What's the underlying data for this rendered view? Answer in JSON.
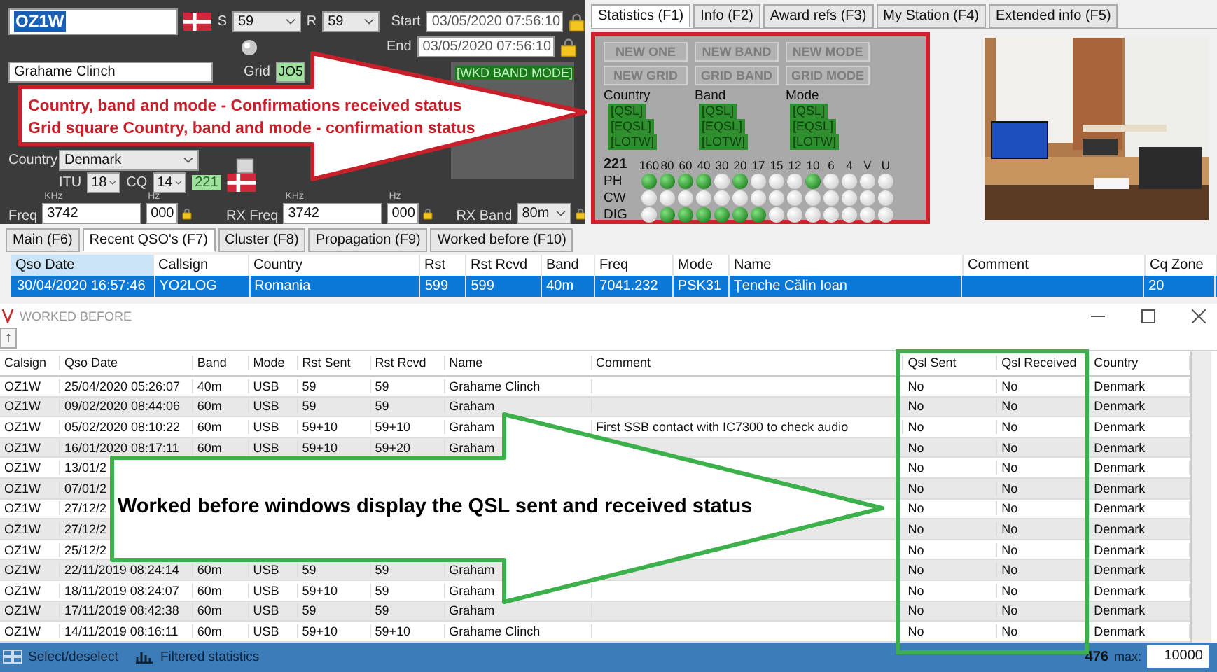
{
  "entry_panel": {
    "callsign": "OZ1W",
    "s_label": "S",
    "s_value": "59",
    "r_label": "R",
    "r_value": "59",
    "start_label": "Start",
    "start": "03/05/2020 07:56:10",
    "end_label": "End",
    "end": "03/05/2020 07:56:10",
    "name": "Grahame Clinch",
    "grid_label": "Grid",
    "grid": "JO5",
    "wkd_tags": [
      "[WKD BAND MODE]"
    ],
    "country_label": "Country",
    "country": "Denmark",
    "itu_label": "ITU",
    "itu": "18",
    "cq_label": "CQ",
    "cq": "14",
    "count": "221",
    "khz_unit": "KHz",
    "hz_unit": "Hz",
    "freq_label": "Freq",
    "freq": "3742",
    "freq_hz": "000",
    "rx_freq_label": "RX Freq",
    "rx_khz_unit": "KHz",
    "rx_hz_unit": "Hz",
    "rx_freq": "3742",
    "rx_freq_hz": "000",
    "rx_band_label": "RX Band",
    "rx_band": "80m"
  },
  "info_tabs": [
    {
      "label": "Statistics (F1)",
      "selected": true
    },
    {
      "label": "Info (F2)",
      "selected": false
    },
    {
      "label": "Award refs (F3)",
      "selected": false
    },
    {
      "label": "My Station (F4)",
      "selected": false
    },
    {
      "label": "Extended info (F5)",
      "selected": false
    }
  ],
  "statistics": {
    "alerts": [
      {
        "label": "NEW ONE",
        "disabled": true
      },
      {
        "label": "NEW BAND",
        "disabled": true
      },
      {
        "label": "NEW MODE",
        "disabled": true
      },
      {
        "label": "NEW GRID",
        "disabled": true
      },
      {
        "label": "GRID BAND",
        "disabled": true
      },
      {
        "label": "GRID MODE",
        "disabled": true
      }
    ],
    "groups": [
      {
        "title": "Country",
        "tags": [
          "[QSL]",
          "[EQSL]",
          "[LOTW]"
        ]
      },
      {
        "title": "Band",
        "tags": [
          "[QSL]",
          "[EQSL]",
          "[LOTW]"
        ]
      },
      {
        "title": "Mode",
        "tags": [
          "[QSL]",
          "[EQSL]",
          "[LOTW]"
        ]
      }
    ],
    "total": "221",
    "bands": [
      "160",
      "80",
      "60",
      "40",
      "30",
      "20",
      "17",
      "15",
      "12",
      "10",
      "6",
      "4",
      "V",
      "U"
    ],
    "modes": [
      {
        "label": "PH",
        "worked": [
          true,
          true,
          true,
          true,
          false,
          true,
          false,
          false,
          false,
          true,
          false,
          false,
          false,
          false
        ]
      },
      {
        "label": "CW",
        "worked": [
          false,
          false,
          false,
          false,
          false,
          false,
          false,
          false,
          false,
          false,
          false,
          false,
          false,
          false
        ]
      },
      {
        "label": "DIG",
        "worked": [
          false,
          true,
          true,
          true,
          true,
          true,
          true,
          false,
          false,
          false,
          false,
          false,
          false,
          false
        ]
      }
    ]
  },
  "bottom_tabs": [
    {
      "label": "Main (F6)",
      "selected": false
    },
    {
      "label": "Recent QSO's (F7)",
      "selected": true
    },
    {
      "label": "Cluster (F8)",
      "selected": false
    },
    {
      "label": "Propagation (F9)",
      "selected": false
    },
    {
      "label": "Worked before (F10)",
      "selected": false
    }
  ],
  "recent_qsos": {
    "columns": [
      {
        "label": "Qso Date",
        "selected": true
      },
      {
        "label": "Callsign",
        "selected": false
      },
      {
        "label": "Country",
        "selected": false
      },
      {
        "label": "Rst",
        "selected": false
      },
      {
        "label": "Rst Rcvd",
        "selected": false
      },
      {
        "label": "Band",
        "selected": false
      },
      {
        "label": "Freq",
        "selected": false
      },
      {
        "label": "Mode",
        "selected": false
      },
      {
        "label": "Name",
        "selected": false
      },
      {
        "label": "Comment",
        "selected": false
      },
      {
        "label": "Cq Zone",
        "selected": false
      }
    ],
    "rows": [
      {
        "selected": true,
        "cells": [
          "30/04/2020 16:57:46",
          "YO2LOG",
          "Romania",
          "599",
          "599",
          "40m",
          "7041.232",
          "PSK31",
          "Țenche Călin Ioan",
          null,
          "20"
        ]
      }
    ]
  },
  "worked_before": {
    "title": "WORKED BEFORE",
    "toolbar_button": "↑",
    "columns": [
      "Calsign",
      "Qso Date",
      "Band",
      "Mode",
      "Rst Sent",
      "Rst Rcvd",
      "Name",
      "Comment",
      "Qsl Sent",
      "Qsl Received",
      "Country"
    ],
    "rows": [
      [
        "OZ1W",
        "25/04/2020 05:26:07",
        "40m",
        "USB",
        "59",
        "59",
        "Grahame Clinch",
        null,
        "No",
        "No",
        "Denmark"
      ],
      [
        "OZ1W",
        "09/02/2020 08:44:06",
        "60m",
        "USB",
        "59",
        "59",
        "Graham",
        null,
        "No",
        "No",
        "Denmark"
      ],
      [
        "OZ1W",
        "05/02/2020 08:10:22",
        "60m",
        "USB",
        "59+10",
        "59+10",
        "Graham",
        "First SSB contact with IC7300 to check audio",
        "No",
        "No",
        "Denmark"
      ],
      [
        "OZ1W",
        "16/01/2020 08:17:11",
        "60m",
        "USB",
        "59+10",
        "59+20",
        "Graham",
        null,
        "No",
        "No",
        "Denmark"
      ],
      [
        "OZ1W",
        "13/01/2",
        null,
        null,
        null,
        null,
        null,
        null,
        "No",
        "No",
        "Denmark"
      ],
      [
        "OZ1W",
        "07/01/2",
        null,
        null,
        null,
        null,
        null,
        null,
        "No",
        "No",
        "Denmark"
      ],
      [
        "OZ1W",
        "27/12/2",
        null,
        null,
        null,
        null,
        null,
        null,
        "No",
        "No",
        "Denmark"
      ],
      [
        "OZ1W",
        "27/12/2",
        null,
        null,
        null,
        null,
        null,
        null,
        "No",
        "No",
        "Denmark"
      ],
      [
        "OZ1W",
        "25/12/2",
        null,
        null,
        null,
        null,
        null,
        null,
        "No",
        "No",
        "Denmark"
      ],
      [
        "OZ1W",
        "22/11/2019 08:24:14",
        "60m",
        "USB",
        "59",
        "59",
        "Graham",
        null,
        "No",
        "No",
        "Denmark"
      ],
      [
        "OZ1W",
        "18/11/2019 08:24:07",
        "60m",
        "USB",
        "59+10",
        "59",
        "Graham",
        null,
        "No",
        "No",
        "Denmark"
      ],
      [
        "OZ1W",
        "17/11/2019 08:42:38",
        "60m",
        "USB",
        "59",
        "59",
        "Graham",
        null,
        "No",
        "No",
        "Denmark"
      ],
      [
        "OZ1W",
        "14/11/2019 08:16:11",
        "60m",
        "USB",
        "59+10",
        "59+10",
        "Grahame Clinch",
        null,
        "No",
        "No",
        "Denmark"
      ]
    ],
    "status": {
      "select": "Select/deselect",
      "filtered": "Filtered statistics",
      "total": "476",
      "max_label": "max:",
      "max": "10000"
    }
  },
  "annotations": [
    {
      "kind": "red-arrow",
      "lines": [
        "Country, band and mode - Confirmations received status",
        "Grid square Country, band and mode - confirmation status"
      ]
    },
    {
      "kind": "green-arrow",
      "lines": [
        "Worked before windows display the QSL sent and received status"
      ]
    },
    {
      "kind": "green-frame"
    }
  ]
}
